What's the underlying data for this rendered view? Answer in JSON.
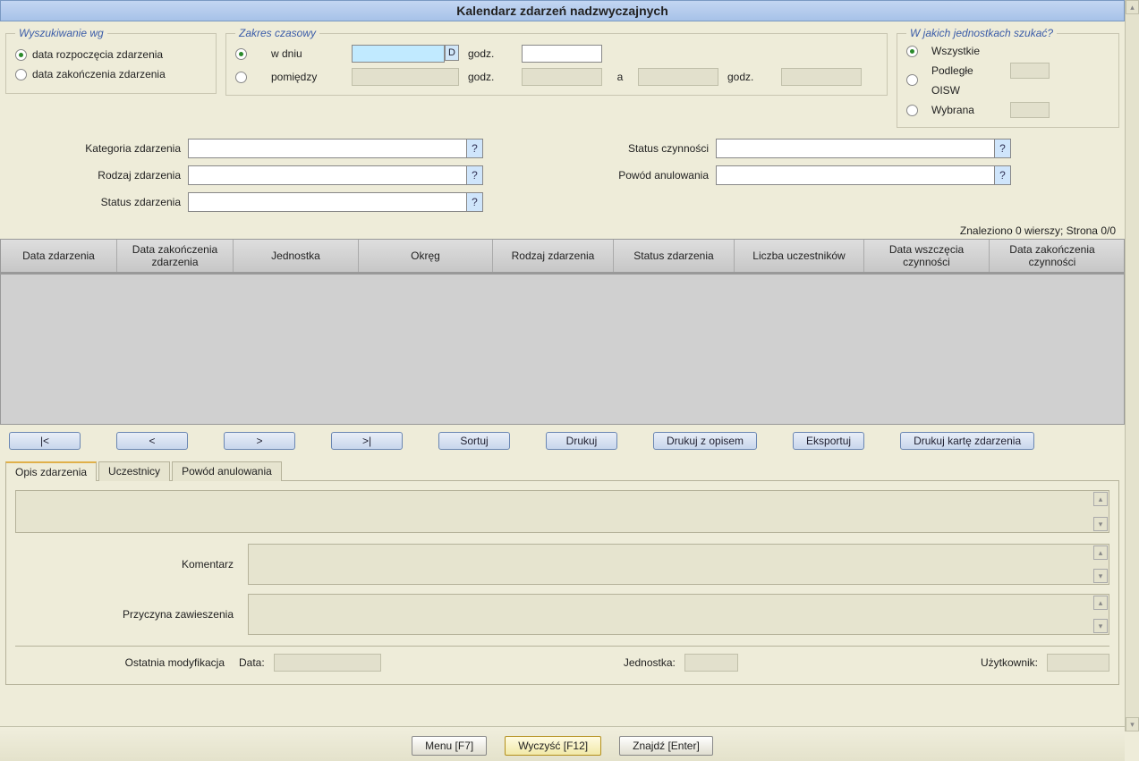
{
  "header": {
    "title": "Kalendarz zdarzeń nadzwyczajnych"
  },
  "search_by": {
    "legend": "Wyszukiwanie wg",
    "opt1": "data rozpoczęcia zdarzenia",
    "opt2": "data zakończenia zdarzenia"
  },
  "time_range": {
    "legend": "Zakres czasowy",
    "opt1": "w dniu",
    "opt2": "pomiędzy",
    "d_btn": "D",
    "godz": "godz.",
    "a": "a"
  },
  "units": {
    "legend": "W jakich jednostkach szukać?",
    "opt1": "Wszystkie",
    "opt2a": "Podległe",
    "opt2b": "OISW",
    "opt3": "Wybrana"
  },
  "filters": {
    "kategoria": "Kategoria zdarzenia",
    "rodzaj": "Rodzaj zdarzenia",
    "status_zd": "Status zdarzenia",
    "status_cz": "Status czynności",
    "powod": "Powód anulowania",
    "q": "?"
  },
  "found": "Znaleziono 0 wierszy; Strona 0/0",
  "cols": {
    "c1": "Data zdarzenia",
    "c2": "Data zakończenia zdarzenia",
    "c3": "Jednostka",
    "c4": "Okręg",
    "c5": "Rodzaj zdarzenia",
    "c6": "Status zdarzenia",
    "c7": "Liczba uczestników",
    "c8": "Data wszczęcia czynności",
    "c9": "Data zakończenia czynności"
  },
  "buttons": {
    "first": "|<",
    "prev": "<",
    "next": ">",
    "last": ">|",
    "sort": "Sortuj",
    "print": "Drukuj",
    "print_desc": "Drukuj z opisem",
    "export": "Eksportuj",
    "print_card": "Drukuj kartę zdarzenia"
  },
  "tabs": {
    "t1": "Opis zdarzenia",
    "t2": "Uczestnicy",
    "t3": "Powód anulowania"
  },
  "details": {
    "komentarz": "Komentarz",
    "przyczyna": "Przyczyna zawieszenia",
    "lastmod": "Ostatnia modyfikacja",
    "data": "Data:",
    "jednostka": "Jednostka:",
    "uzytkownik": "Użytkownik:"
  },
  "footer": {
    "menu": "Menu [F7]",
    "clear": "Wyczyść [F12]",
    "find": "Znajdź [Enter]"
  }
}
